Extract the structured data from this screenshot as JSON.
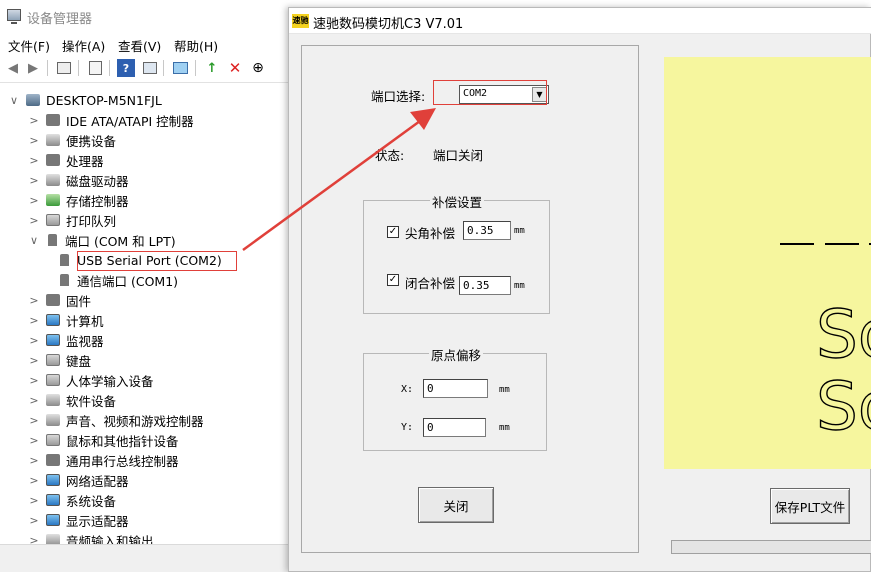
{
  "device_manager": {
    "title": "设备管理器",
    "menu": [
      "文件(F)",
      "操作(A)",
      "查看(V)",
      "帮助(H)"
    ],
    "toolbar_icons": [
      "back-arrow-icon",
      "forward-arrow-icon",
      "properties-icon",
      "device-list-icon",
      "help-icon",
      "view-icon",
      "scan-hardware-icon",
      "update-driver-icon",
      "uninstall-icon",
      "disable-icon"
    ],
    "tree": {
      "root": "DESKTOP-M5N1FJL",
      "items": [
        {
          "label": "IDE ATA/ATAPI 控制器",
          "icon": "chip",
          "expanded": false
        },
        {
          "label": "便携设备",
          "icon": "disk",
          "expanded": false
        },
        {
          "label": "处理器",
          "icon": "chip",
          "expanded": false
        },
        {
          "label": "磁盘驱动器",
          "icon": "disk",
          "expanded": false
        },
        {
          "label": "存储控制器",
          "icon": "green",
          "expanded": false
        },
        {
          "label": "打印队列",
          "icon": "gray",
          "expanded": false
        },
        {
          "label": "端口 (COM 和 LPT)",
          "icon": "port",
          "expanded": true
        },
        {
          "label": "USB Serial Port (COM2)",
          "icon": "port",
          "child": true,
          "highlighted": true
        },
        {
          "label": "通信端口 (COM1)",
          "icon": "port",
          "child": true
        },
        {
          "label": "固件",
          "icon": "chip",
          "expanded": false
        },
        {
          "label": "计算机",
          "icon": "mon",
          "expanded": false
        },
        {
          "label": "监视器",
          "icon": "mon",
          "expanded": false
        },
        {
          "label": "键盘",
          "icon": "gray",
          "expanded": false
        },
        {
          "label": "人体学输入设备",
          "icon": "gray",
          "expanded": false
        },
        {
          "label": "软件设备",
          "icon": "disk",
          "expanded": false
        },
        {
          "label": "声音、视频和游戏控制器",
          "icon": "disk",
          "expanded": false
        },
        {
          "label": "鼠标和其他指针设备",
          "icon": "gray",
          "expanded": false
        },
        {
          "label": "通用串行总线控制器",
          "icon": "chip",
          "expanded": false
        },
        {
          "label": "网络适配器",
          "icon": "mon",
          "expanded": false
        },
        {
          "label": "系统设备",
          "icon": "mon",
          "expanded": false
        },
        {
          "label": "显示适配器",
          "icon": "mon",
          "expanded": false
        },
        {
          "label": "音频输入和输出",
          "icon": "disk",
          "expanded": false
        }
      ]
    }
  },
  "app": {
    "title": "速驰数码模切机C3 V7.01",
    "logo_text": "速驰",
    "port_label": "端口选择:",
    "port_value": "COM2",
    "status_label": "状态:",
    "status_value": "端口关闭",
    "compensation": {
      "title": "补偿设置",
      "sharp_label": "尖角补偿",
      "sharp_value": "0.35",
      "sharp_checked": true,
      "close_label": "闭合补偿",
      "close_value": "0.35",
      "close_checked": true,
      "unit": "mm"
    },
    "origin": {
      "title": "原点偏移",
      "x_label": "X:",
      "x_value": "0",
      "y_label": "Y:",
      "y_value": "0",
      "unit": "mm"
    },
    "close_button": "关闭",
    "save_plt_button": "保存PLT文件",
    "preview_text": [
      "So",
      "So"
    ]
  },
  "colors": {
    "highlight": "#e0403a",
    "preview_bg": "#f6f69e",
    "app_bg": "#f0f0f0"
  }
}
